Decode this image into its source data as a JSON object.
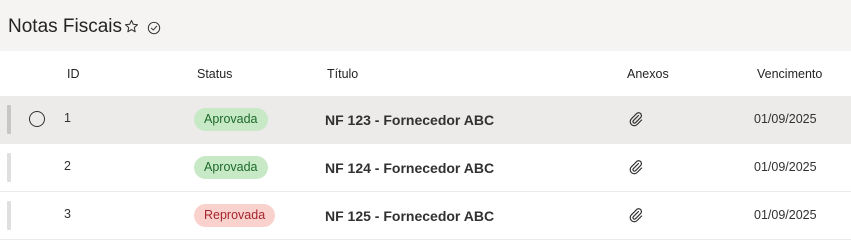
{
  "list": {
    "title": "Notas Fiscais",
    "icons": {
      "favorite": "star-icon",
      "status": "check-circle-icon"
    }
  },
  "columns": {
    "id": "ID",
    "status": "Status",
    "titulo": "Título",
    "anexos": "Anexos",
    "vencimento": "Vencimento"
  },
  "rows": [
    {
      "id": "1",
      "status": "Aprovada",
      "status_type": "approved",
      "title": "NF 123 - Fornecedor ABC",
      "attachment_icon": "paperclip-icon",
      "due": "01/09/2025",
      "selected": true
    },
    {
      "id": "2",
      "status": "Aprovada",
      "status_type": "approved",
      "title": "NF 124 - Fornecedor ABC",
      "attachment_icon": "paperclip-icon",
      "due": "01/09/2025",
      "selected": false
    },
    {
      "id": "3",
      "status": "Reprovada",
      "status_type": "rejected",
      "title": "NF 125 - Fornecedor ABC",
      "attachment_icon": "paperclip-icon",
      "due": "01/09/2025",
      "selected": false
    }
  ],
  "colors": {
    "approved_bg": "#c7e9c6",
    "approved_text": "#1e6a2a",
    "rejected_bg": "#f9d1cd",
    "rejected_text": "#a4262c",
    "selected_row": "#edebe9"
  }
}
